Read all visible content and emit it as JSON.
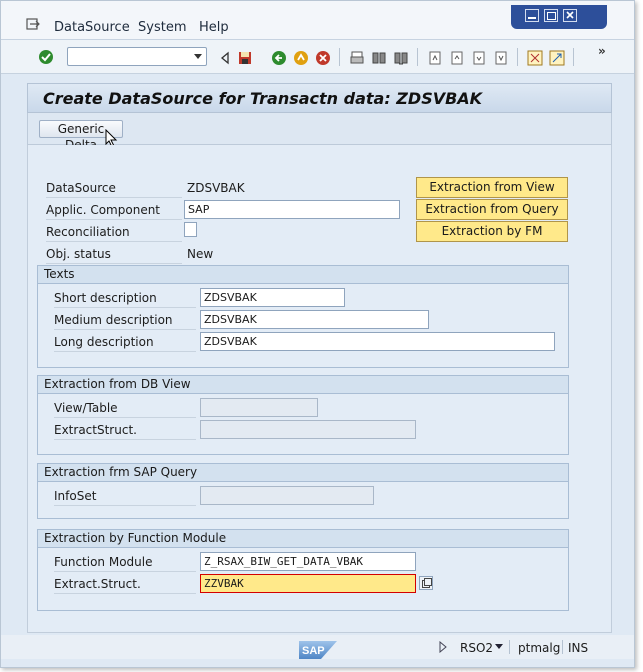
{
  "menubar": {
    "items": [
      "DataSource",
      "System",
      "Help"
    ]
  },
  "toolbar": {
    "command_field": "",
    "icons": [
      "enter-icon",
      "back-icon",
      "save-icon",
      "back-green-icon",
      "exit-icon",
      "cancel-icon",
      "print-icon",
      "find-icon",
      "find-next-icon",
      "first-page-icon",
      "prev-page-icon",
      "next-page-icon",
      "last-page-icon",
      "new-session-icon",
      "shortcut-icon",
      "more-icon"
    ]
  },
  "title": "Create DataSource for Transactn data: ZDSVBAK",
  "app_toolbar": {
    "generic_delta": "Generic Delta"
  },
  "header": {
    "datasource_label": "DataSource",
    "datasource_value": "ZDSVBAK",
    "applic_label": "Applic. Component",
    "applic_value": "SAP",
    "recon_label": "Reconciliation",
    "objstatus_label": "Obj. status",
    "objstatus_value": "New"
  },
  "buttons": {
    "from_view": "Extraction from View",
    "from_query": "Extraction from Query",
    "by_fm": "Extraction by FM"
  },
  "texts_group": {
    "title": "Texts",
    "short_label": "Short description",
    "short_value": "ZDSVBAK",
    "medium_label": "Medium description",
    "medium_value": "ZDSVBAK",
    "long_label": "Long description",
    "long_value": "ZDSVBAK"
  },
  "dbview_group": {
    "title": "Extraction from DB View",
    "view_label": "View/Table",
    "view_value": "",
    "struct_label": "ExtractStruct.",
    "struct_value": ""
  },
  "query_group": {
    "title": "Extraction frm SAP Query",
    "infoset_label": "InfoSet",
    "infoset_value": ""
  },
  "fm_group": {
    "title": "Extraction by Function Module",
    "fm_label": "Function Module",
    "fm_value": "Z_RSAX_BIW_GET_DATA_VBAK",
    "struct_label": "Extract.Struct.",
    "struct_value": "ZZVBAK"
  },
  "status_bar": {
    "logo": "SAP",
    "transaction": "RSO2",
    "server": "ptmalg",
    "mode": "INS"
  },
  "colors": {
    "highlight_yellow": "#ffe98a",
    "window_blue": "#2d4f9a",
    "error_red": "#d40000"
  }
}
